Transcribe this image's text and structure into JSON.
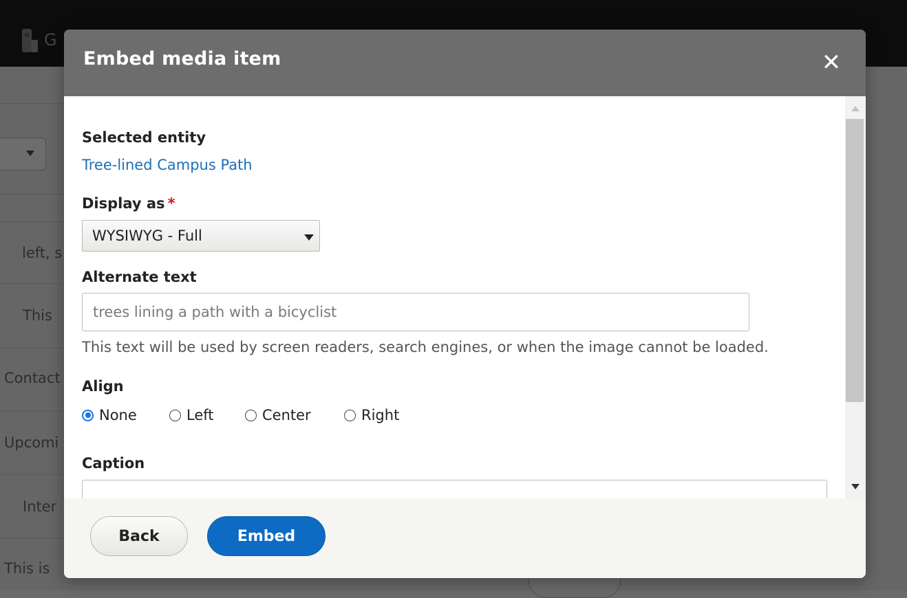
{
  "background_page": {
    "topbar_fragment": "G",
    "row_fragments": [
      "left, s",
      "This",
      "Contact",
      "Upcomi",
      "Inter",
      "This is"
    ]
  },
  "dialog": {
    "title": "Embed media item",
    "close_icon": "close-icon",
    "close_glyph": "✕",
    "selected_entity": {
      "label": "Selected entity",
      "link_text": "Tree-lined Campus Path"
    },
    "display_as": {
      "label": "Display as",
      "required_mark": "*",
      "selected_value": "WYSIWYG - Full"
    },
    "alternate_text": {
      "label": "Alternate text",
      "value": "trees lining a path with a bicyclist",
      "help": "This text will be used by screen readers, search engines, or when the image cannot be loaded."
    },
    "align": {
      "label": "Align",
      "options": [
        "None",
        "Left",
        "Center",
        "Right"
      ],
      "selected": "None"
    },
    "caption": {
      "label": "Caption",
      "value": ""
    },
    "footer": {
      "back_label": "Back",
      "embed_label": "Embed"
    }
  },
  "colors": {
    "accent": "#0e6bc4",
    "link": "#1c6fb5",
    "required": "#d11a1a",
    "header": "#6d6d6d"
  }
}
